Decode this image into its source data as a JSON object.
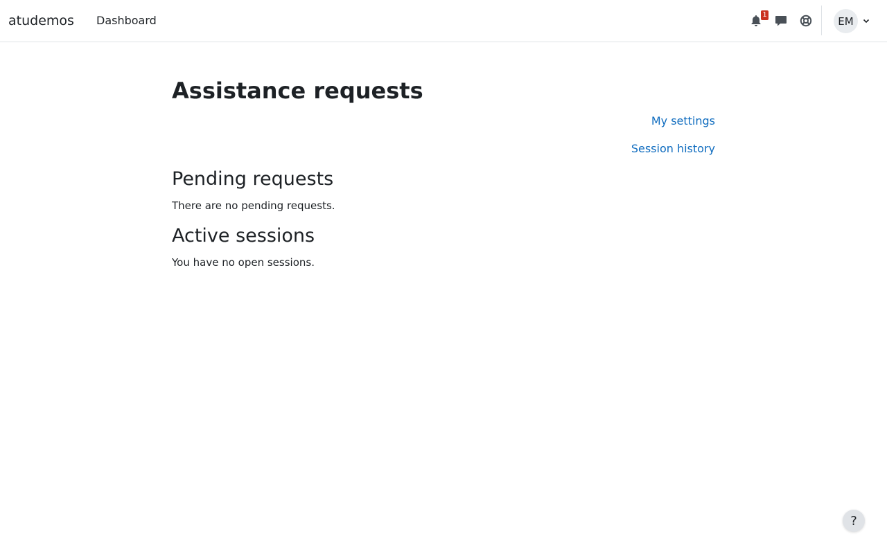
{
  "navbar": {
    "brand": "atudemos",
    "links": [
      {
        "label": "Dashboard"
      }
    ],
    "notification_count": "1",
    "icons": [
      "bell-icon",
      "chat-icon",
      "lifebuoy-icon",
      "chevron-down-icon"
    ],
    "user_initials": "EM"
  },
  "main": {
    "title": "Assistance requests",
    "side_links": [
      {
        "label": "My settings"
      },
      {
        "label": "Session history"
      }
    ],
    "sections": [
      {
        "heading": "Pending requests",
        "text": "There are no pending requests."
      },
      {
        "heading": "Active sessions",
        "text": "You have no open sessions."
      }
    ]
  },
  "help": {
    "label": "?"
  },
  "colors": {
    "link": "#0f6cbf",
    "badge": "#ca3120",
    "text": "#1d2125",
    "border": "#dee2e6"
  }
}
